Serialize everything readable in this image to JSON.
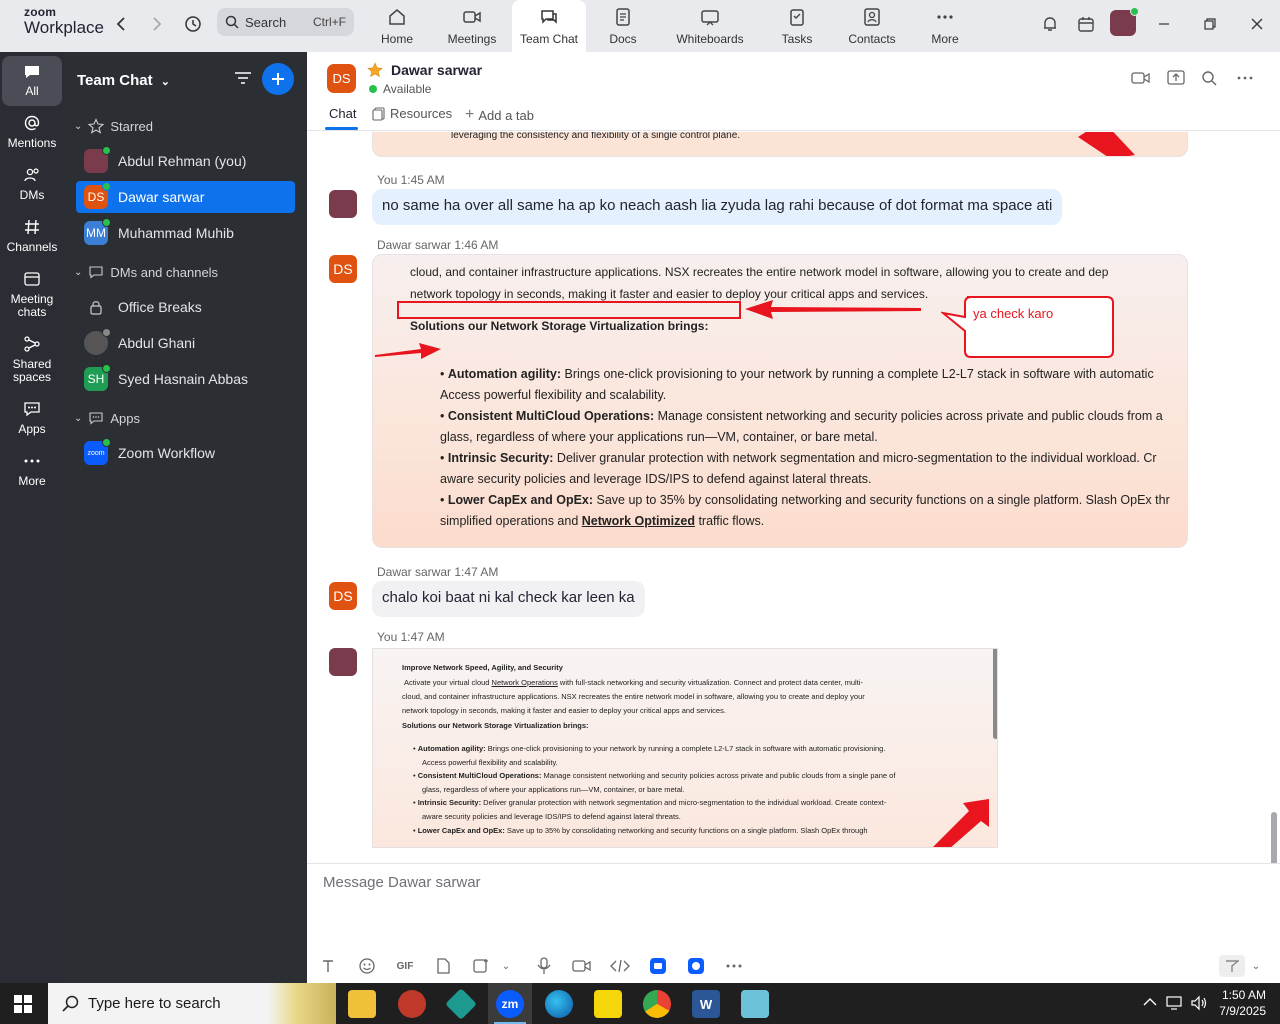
{
  "app": {
    "brand_top": "zoom",
    "brand_name": "Workplace"
  },
  "search": {
    "label": "Search",
    "shortcut": "Ctrl+F"
  },
  "top_tabs": [
    {
      "label": "Home",
      "icon": "home-icon"
    },
    {
      "label": "Meetings",
      "icon": "video-icon"
    },
    {
      "label": "Team Chat",
      "icon": "chat-icon",
      "active": true
    },
    {
      "label": "Docs",
      "icon": "docs-icon"
    },
    {
      "label": "Whiteboards",
      "icon": "whiteboard-icon"
    },
    {
      "label": "Tasks",
      "icon": "tasks-icon"
    },
    {
      "label": "Contacts",
      "icon": "contacts-icon"
    },
    {
      "label": "More",
      "icon": "more-icon"
    }
  ],
  "rail": [
    {
      "label": "All",
      "active": true
    },
    {
      "label": "Mentions"
    },
    {
      "label": "DMs"
    },
    {
      "label": "Channels"
    },
    {
      "label": "Meeting chats"
    },
    {
      "label": "Shared spaces"
    },
    {
      "label": "Apps"
    },
    {
      "label": "More"
    }
  ],
  "sidebar": {
    "title": "Team Chat",
    "starred_label": "Starred",
    "starred": [
      {
        "name": "Abdul Rehman (you)",
        "initials": "",
        "color": "#7a3b4c"
      },
      {
        "name": "Dawar sarwar",
        "initials": "DS",
        "color": "#e0520f",
        "selected": true
      },
      {
        "name": "Muhammad Muhib",
        "initials": "MM",
        "color": "#3b7fd6"
      }
    ],
    "dms_label": "DMs and channels",
    "dms": [
      {
        "name": "Office Breaks",
        "initials": "",
        "color": ""
      },
      {
        "name": "Abdul Ghani",
        "initials": "",
        "color": "#555"
      },
      {
        "name": "Syed Hasnain Abbas",
        "initials": "SH",
        "color": "#1f9d55"
      }
    ],
    "apps_label": "Apps",
    "apps": [
      {
        "name": "Zoom Workflow",
        "initials": "zoom",
        "color": "#0b5cff"
      }
    ]
  },
  "chat": {
    "contact_name": "Dawar sarwar",
    "contact_initials": "DS",
    "status": "Available",
    "tabs": {
      "chat": "Chat",
      "resources": "Resources",
      "add_tab": "Add a tab"
    }
  },
  "messages": {
    "top_fragment": "leveraging the consistency and flexibility of a single control plane.",
    "m1": {
      "sender": "You",
      "time": "1:45 AM",
      "text": "no same ha  over all same ha ap ko neach aash lia zyuda lag rahi because of dot format ma space ati"
    },
    "m2": {
      "sender": "Dawar sarwar",
      "time": "1:46 AM"
    },
    "m3": {
      "sender": "Dawar sarwar",
      "time": "1:47 AM",
      "text": "chalo koi baat ni kal check kar leen ka"
    },
    "m4": {
      "sender": "You",
      "time": "1:47 AM"
    }
  },
  "image1": {
    "line1": "cloud, and container infrastructure applications. NSX recreates the entire network model in software, allowing you to create and dep",
    "line2": "network topology in seconds, making it faster and easier to deploy your critical apps and services.",
    "callout": "ya check karo",
    "heading": "Solutions our Network Storage Virtualization brings:",
    "bullets": [
      {
        "title": "Automation agility:",
        "text": " Brings one-click provisioning to your network by running a complete L2-L7 stack in software with automatic",
        "cont": "Access powerful flexibility and scalability."
      },
      {
        "title": "Consistent MultiCloud Operations:",
        "text": " Manage consistent networking and security policies across private and public clouds from a",
        "cont": "glass, regardless of where your applications run—VM, container, or bare metal."
      },
      {
        "title": "Intrinsic Security:",
        "text": " Deliver granular protection with network segmentation and micro-segmentation to the individual workload. Cr",
        "cont": "aware security policies and leverage IDS/IPS to defend against lateral threats."
      },
      {
        "title": "Lower CapEx and OpEx:",
        "text": " Save up to 35% by consolidating networking and security functions on a single platform. Slash OpEx thr",
        "cont_pre": "simplified operations and ",
        "cont_link": "Network Optimized",
        "cont_post": " traffic flows."
      }
    ]
  },
  "image2": {
    "title": "Improve Network Speed, Agility, and Security",
    "p1_pre": "Activate your virtual cloud ",
    "p1_link": "Network Operations",
    "p1_post": " with full-stack networking and security virtualization. Connect and protect data center, multi-",
    "p2": "cloud, and container infrastructure applications. NSX recreates the entire network model in software, allowing you to create and deploy your",
    "p3": "network topology in seconds, making it faster and easier to deploy your critical apps and services.",
    "heading": "Solutions our Network Storage Virtualization brings:",
    "bullets": [
      {
        "title": "Automation agility:",
        "text": " Brings one-click provisioning to your network by running a complete L2-L7 stack in software with automatic provisioning.",
        "cont": "Access powerful flexibility and scalability."
      },
      {
        "title": "Consistent MultiCloud Operations:",
        "text": " Manage consistent networking and security policies across private and public clouds from a single pane of",
        "cont": "glass, regardless of where your applications run—VM, container, or bare metal."
      },
      {
        "title": "Intrinsic Security:",
        "text": " Deliver granular protection with network segmentation and micro-segmentation to the individual workload. Create context-",
        "cont": "aware security policies and leverage IDS/IPS to defend against lateral threats."
      },
      {
        "title": "Lower CapEx and OpEx:",
        "text": " Save up to 35% by consolidating networking and security functions on a single platform. Slash OpEx through",
        "cont": ""
      }
    ]
  },
  "composer": {
    "placeholder": "Message Dawar sarwar",
    "gif": "GIF"
  },
  "taskbar": {
    "search": "Type here to search",
    "time": "1:50 AM",
    "date": "7/9/2025"
  },
  "colors": {
    "accent": "#0e72ed",
    "sidebar": "#2b2e33",
    "rail": "#2a2d33",
    "online": "#27c24c",
    "annotation": "#e8141e"
  }
}
